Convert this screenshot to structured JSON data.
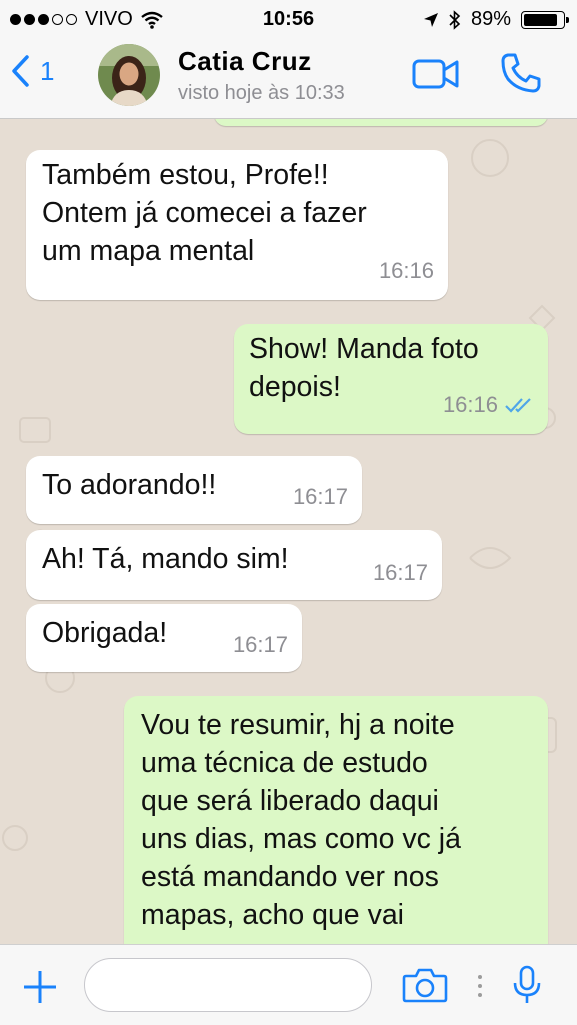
{
  "status_bar": {
    "carrier": "VIVO",
    "time": "10:56",
    "battery": "89%",
    "battery_level": 0.89
  },
  "header": {
    "back_count": "1",
    "contact_name": "Catia  Cruz",
    "last_seen": "visto hoje às 10:33",
    "icons": [
      "back-chevron-icon",
      "avatar",
      "video-camera-icon",
      "phone-icon"
    ]
  },
  "messages": [
    {
      "direction": "in",
      "text": "Também estou, Profe!!\nOntem já comecei a fazer\num mapa mental",
      "time": "16:16"
    },
    {
      "direction": "out",
      "text": "Show! Manda foto\ndepois!",
      "time": "16:16",
      "status": "read"
    },
    {
      "direction": "in",
      "text": "To adorando!!",
      "time": "16:17"
    },
    {
      "direction": "in",
      "text": "Ah! Tá, mando sim!",
      "time": "16:17"
    },
    {
      "direction": "in",
      "text": "Obrigada!",
      "time": "16:17"
    },
    {
      "direction": "out",
      "text": "Vou te resumir, hj a noite\numa técnica de estudo\nque será liberado daqui\nuns dias, mas como vc já\nestá mandando ver nos\nmapas, acho que vai",
      "time": ""
    }
  ],
  "input": {
    "placeholder": "",
    "value": ""
  },
  "colors": {
    "accent": "#1a82fb",
    "outgoing_bubble": "#dcf8c6",
    "incoming_bubble": "#ffffff",
    "chat_background": "#e6ddd3",
    "read_ticks": "#4fa6e8"
  }
}
